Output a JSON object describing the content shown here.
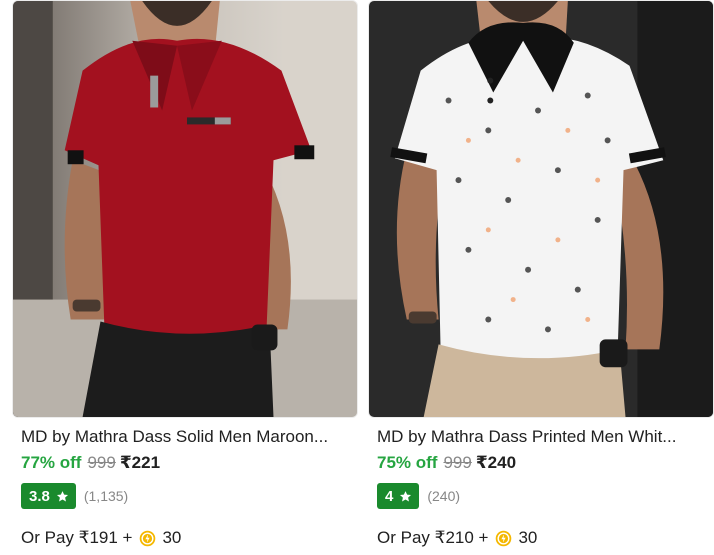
{
  "products": [
    {
      "title": "MD by Mathra Dass Solid Men Maroon...",
      "discount": "77% off",
      "mrp": "999",
      "price": "₹221",
      "rating": "3.8",
      "rating_count": "(1,135)",
      "pay_prefix": "Or Pay ₹191 +",
      "coins": "30",
      "image_alt": "Man wearing maroon polo shirt with black collar tipping",
      "shirt_color": "#a3111f"
    },
    {
      "title": "MD by Mathra Dass Printed Men Whit...",
      "discount": "75% off",
      "mrp": "999",
      "price": "₹240",
      "rating": "4",
      "rating_count": "(240)",
      "pay_prefix": "Or Pay ₹210 +",
      "coins": "30",
      "image_alt": "Man wearing white printed polo shirt with black collar",
      "shirt_color": "#f4f4f4"
    }
  ],
  "colors": {
    "discount": "#26a541",
    "rating_badge": "#1a8a2d",
    "muted": "#878787",
    "coin": "#f5b800"
  },
  "icons": {
    "rating": "star-icon",
    "supercoin": "coin-icon"
  }
}
